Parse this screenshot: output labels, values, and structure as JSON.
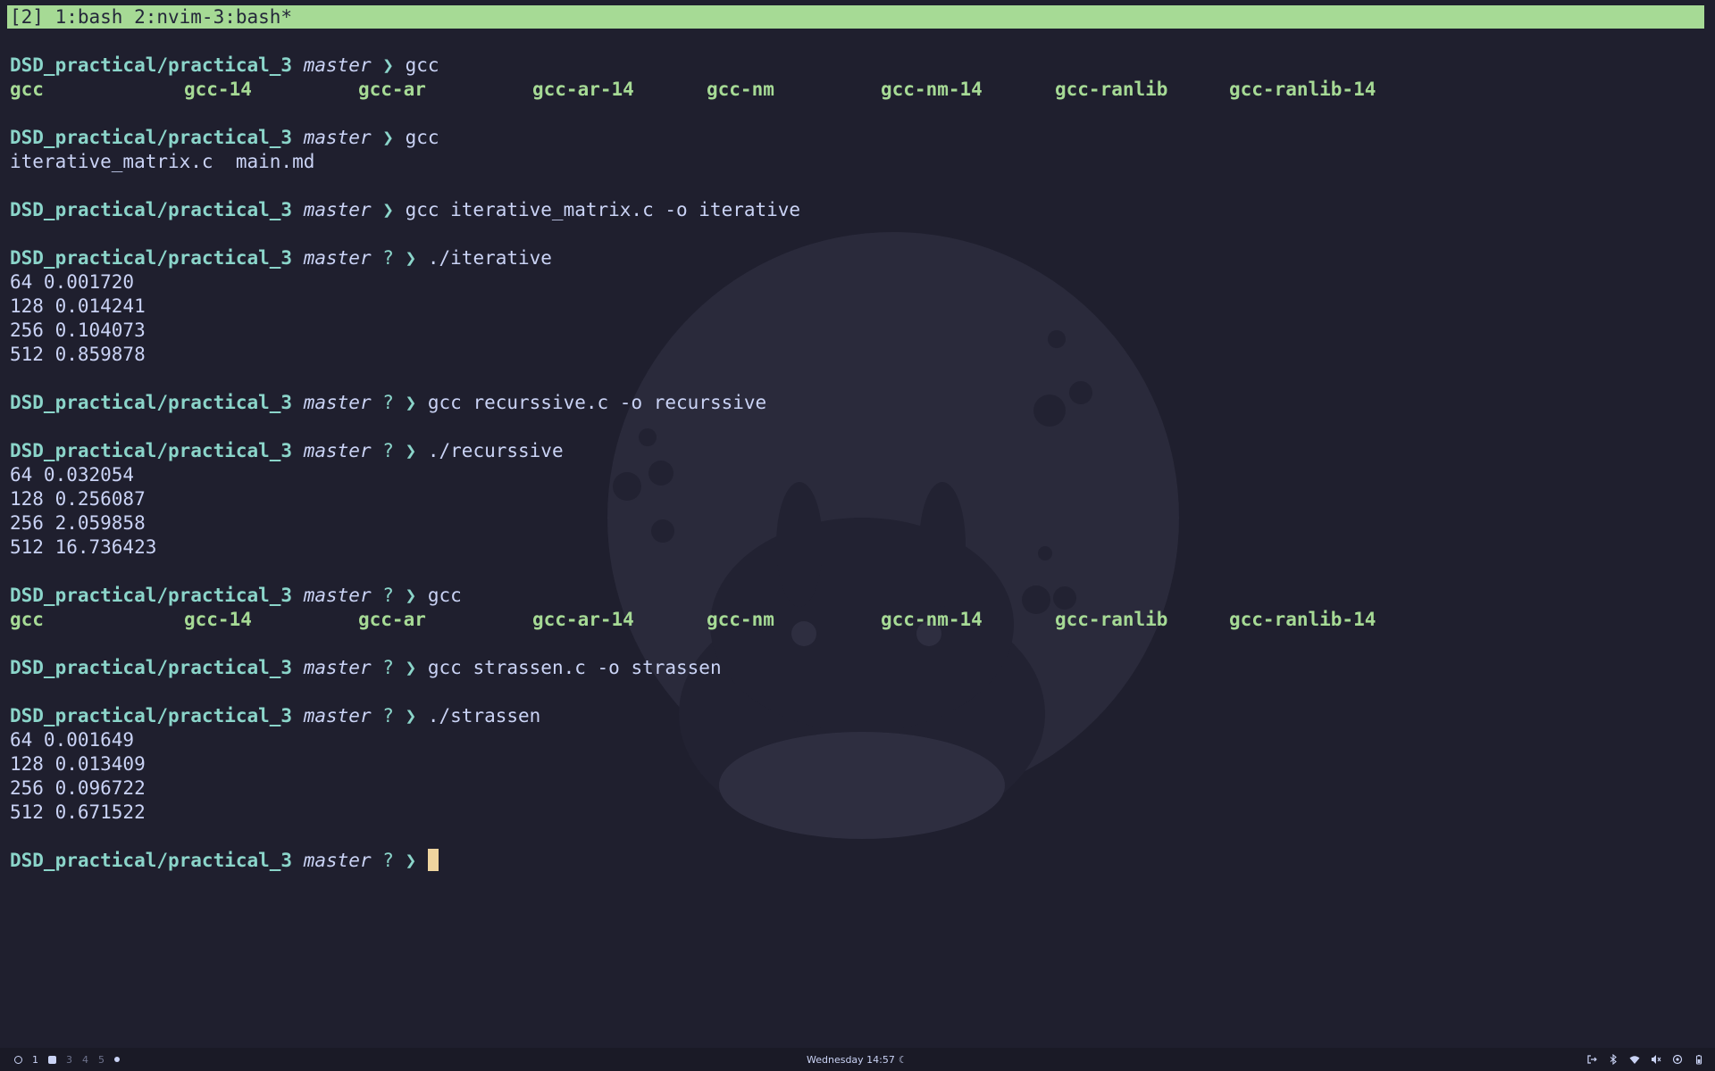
{
  "tmux": {
    "status": "[2] 1:bash 2:nvim-3:bash*"
  },
  "prompt": {
    "path": "DSD_practical/practical_3",
    "branch": "master",
    "dirty_marker": "?",
    "arrow": "❯"
  },
  "blocks": [
    {
      "dirty": false,
      "command": "gcc",
      "completions": [
        "gcc",
        "gcc-14",
        "gcc-ar",
        "gcc-ar-14",
        "gcc-nm",
        "gcc-nm-14",
        "gcc-ranlib",
        "gcc-ranlib-14"
      ]
    },
    {
      "dirty": false,
      "command": "gcc",
      "file_listing": "iterative_matrix.c  main.md"
    },
    {
      "dirty": false,
      "command": "gcc iterative_matrix.c -o iterative"
    },
    {
      "dirty": true,
      "command": "./iterative",
      "output": [
        "64 0.001720",
        "128 0.014241",
        "256 0.104073",
        "512 0.859878"
      ]
    },
    {
      "dirty": true,
      "command": "gcc recurssive.c -o recurssive"
    },
    {
      "dirty": true,
      "command": "./recurssive",
      "output": [
        "64 0.032054",
        "128 0.256087",
        "256 2.059858",
        "512 16.736423"
      ]
    },
    {
      "dirty": true,
      "command": "gcc",
      "completions": [
        "gcc",
        "gcc-14",
        "gcc-ar",
        "gcc-ar-14",
        "gcc-nm",
        "gcc-nm-14",
        "gcc-ranlib",
        "gcc-ranlib-14"
      ]
    },
    {
      "dirty": true,
      "command": "gcc strassen.c -o strassen"
    },
    {
      "dirty": true,
      "command": "./strassen",
      "output": [
        "64 0.001649",
        "128 0.013409",
        "256 0.096722",
        "512 0.671522"
      ]
    },
    {
      "dirty": true,
      "command": "",
      "active": true
    }
  ],
  "statusbar": {
    "workspaces": [
      {
        "label": "1",
        "active": true
      },
      {
        "label": "3",
        "active": false
      },
      {
        "label": "4",
        "active": false
      },
      {
        "label": "5",
        "active": false
      }
    ],
    "clock": "Wednesday 14:57",
    "clock_icon": "moon-icon",
    "tray_icons": [
      "logout-icon",
      "bluetooth-icon",
      "wifi-icon",
      "volume-icon",
      "settings-icon",
      "battery-icon"
    ]
  },
  "colors": {
    "background": "#1f1f2e",
    "tmux_bar": "#a6da95",
    "path": "#8bd5ca",
    "completion": "#a6da95",
    "text": "#cad3f5",
    "cursor": "#eed49f"
  }
}
